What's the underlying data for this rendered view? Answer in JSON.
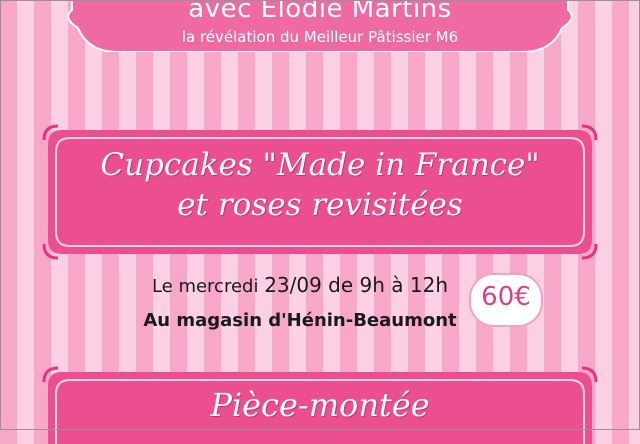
{
  "header": {
    "title": "avec Elodie Martins",
    "subtitle": "la révélation du Meilleur Pâtissier M6"
  },
  "workshop1": {
    "line1": "Cupcakes \"Made in France\"",
    "line2": "et roses revisitées"
  },
  "schedule": {
    "date_prefix": "Le mercredi ",
    "date_value": "23/09 de 9h à 12h",
    "location": "Au magasin d'Hénin-Beaumont"
  },
  "price": {
    "label": "60€"
  },
  "workshop2": {
    "line1": "Pièce-montée"
  },
  "colors": {
    "stripe_dark": "#f7a8c9",
    "stripe_light": "#fbd0e2",
    "banner_fill": "#ec4f90",
    "banner_frame": "#e2377c",
    "price_color": "#e03f84"
  }
}
